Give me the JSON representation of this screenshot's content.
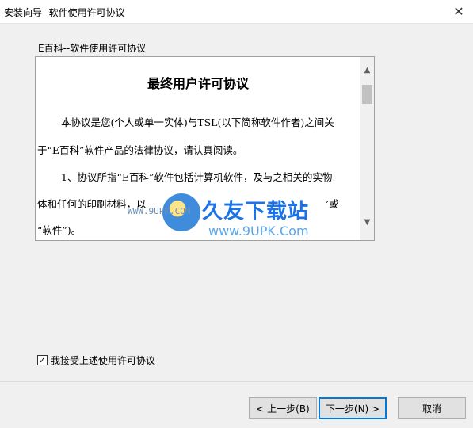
{
  "window": {
    "title": "安装向导--软件使用许可协议",
    "close_glyph": "✕"
  },
  "section": {
    "label": "E百科--软件使用许可协议"
  },
  "license": {
    "title": "最终用户许可协议",
    "lines": [
      "本协议是您(个人或单一实体)与TSL(以下简称软件作者)之间关",
      "于“E百科”软件产品的法律协议，请认真阅读。",
      "1、协议所指“E百科”软件包括计算机软件，及与之相关的实物",
      "体和任何的印刷材料，以",
      "’或",
      "“软件”)。"
    ]
  },
  "scrollbar": {
    "up_glyph": "▲",
    "down_glyph": "▼"
  },
  "watermark": {
    "main": "久友下载站",
    "sub": "www.9UPK.Com",
    "url": "WWW.9UPK.COM"
  },
  "accept": {
    "checked": true,
    "check_glyph": "✓",
    "label": "我接受上述使用许可协议"
  },
  "buttons": {
    "back": "< 上一步(B)",
    "next": "下一步(N) >",
    "cancel": "取消"
  },
  "colors": {
    "accent": "#0078d7",
    "watermark": "#1a73e8"
  }
}
